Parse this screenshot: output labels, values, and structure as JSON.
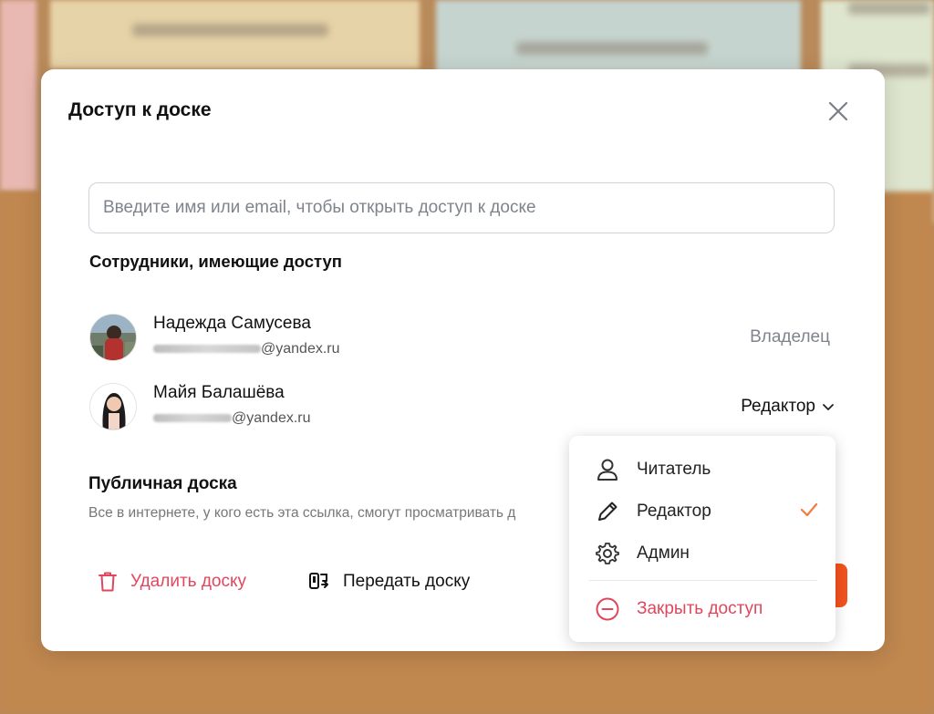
{
  "dialog": {
    "title": "Доступ к доске",
    "search_placeholder": "Введите имя или email, чтобы открыть доступ к доске",
    "members_title": "Сотрудники, имеющие доступ"
  },
  "members": [
    {
      "name": "Надежда Самусева",
      "email_domain": "@yandex.ru",
      "role": "Владелец"
    },
    {
      "name": "Майя Балашёва",
      "email_domain": "@yandex.ru",
      "role": "Редактор"
    }
  ],
  "public_board": {
    "title": "Публичная доска",
    "description": "Все в интернете, у кого есть эта ссылка, смогут просматривать д"
  },
  "actions": {
    "delete_label": "Удалить доску",
    "transfer_label": "Передать доску"
  },
  "role_menu": {
    "items": [
      {
        "label": "Читатель",
        "icon": "user-icon"
      },
      {
        "label": "Редактор",
        "icon": "pencil-icon",
        "selected": true
      },
      {
        "label": "Админ",
        "icon": "gear-icon"
      }
    ],
    "revoke_label": "Закрыть доступ"
  },
  "colors": {
    "danger": "#e2465d",
    "accent": "#f4521f",
    "check": "#f47b3b"
  }
}
